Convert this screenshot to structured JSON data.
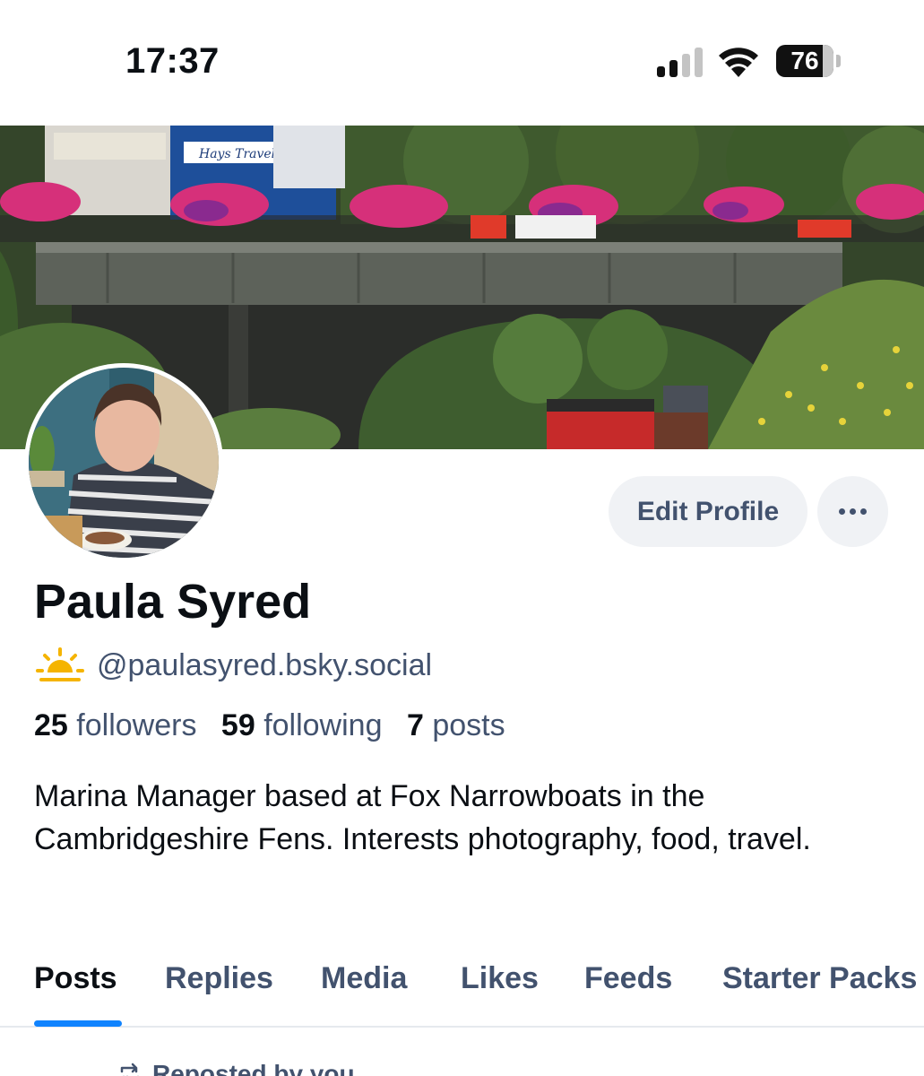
{
  "status_bar": {
    "time": "17:37",
    "battery": "76",
    "icons": [
      "cellular-signal-icon",
      "wifi-icon",
      "battery-icon"
    ]
  },
  "profile": {
    "display_name": "Paula Syred",
    "handle": "@paulasyred.bsky.social",
    "handle_icon": "sun-icon",
    "stats": {
      "followers_count": "25",
      "followers_label": "followers",
      "following_count": "59",
      "following_label": "following",
      "posts_count": "7",
      "posts_label": "posts"
    },
    "bio": "Marina Manager based at Fox Narrowboats in the Cambridgeshire Fens. Interests photography, food, travel."
  },
  "actions": {
    "edit_profile_label": "Edit Profile",
    "more_icon": "more-dots-icon"
  },
  "tabs": [
    {
      "label": "Posts",
      "active": true
    },
    {
      "label": "Replies",
      "active": false
    },
    {
      "label": "Media",
      "active": false
    },
    {
      "label": "Likes",
      "active": false
    },
    {
      "label": "Feeds",
      "active": false
    },
    {
      "label": "Starter Packs",
      "active": false
    }
  ],
  "feed": {
    "repost_label": "Reposted by you",
    "repost_icon": "repost-icon"
  },
  "colors": {
    "accent": "#1083fe",
    "muted_text": "#42526e",
    "button_bg": "#f0f2f5"
  }
}
